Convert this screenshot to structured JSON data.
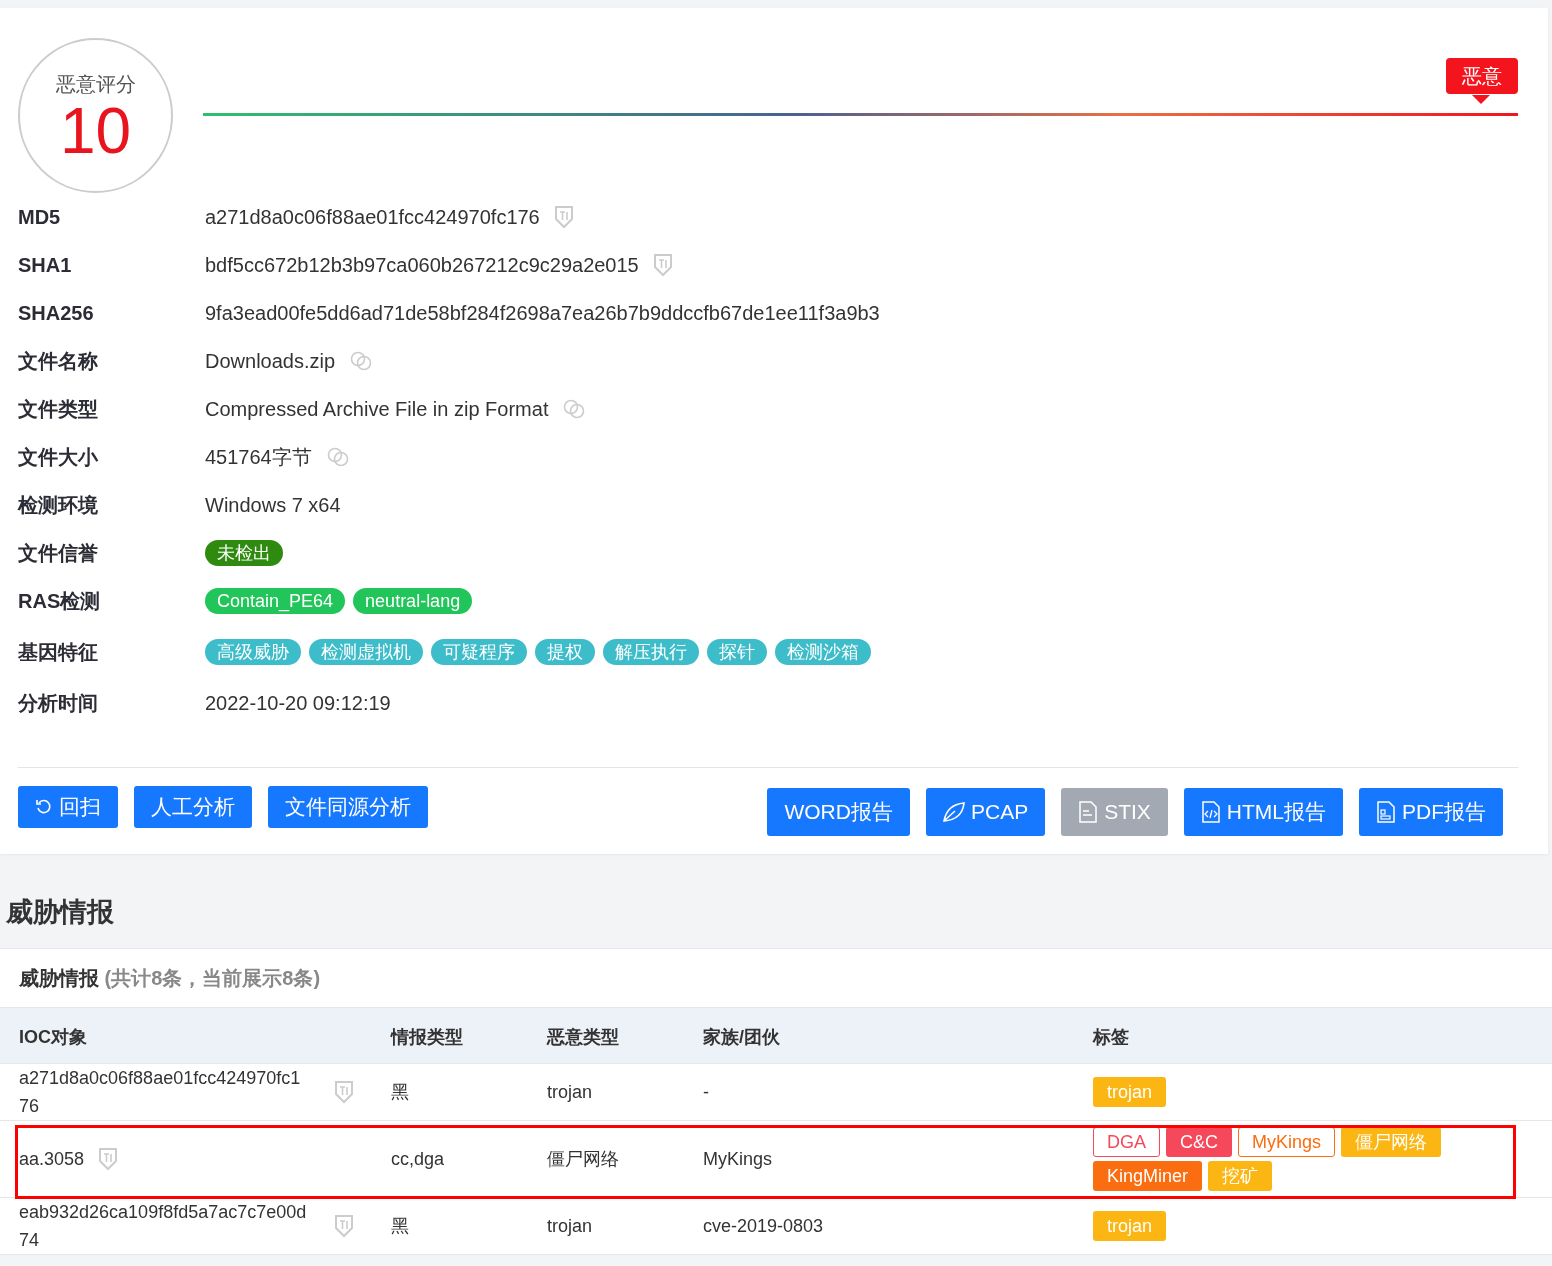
{
  "score": {
    "label": "恶意评分",
    "value": "10",
    "verdict": "恶意"
  },
  "fields": [
    {
      "label": "MD5",
      "kind": "hash",
      "value": "a271d8a0c06f88ae01fcc424970fc176"
    },
    {
      "label": "SHA1",
      "kind": "hash",
      "value": "bdf5cc672b12b3b97ca060b267212c9c29a2e015"
    },
    {
      "label": "SHA256",
      "kind": "text",
      "value": "9fa3ead00fe5dd6ad71de58bf284f2698a7ea26b7b9ddccfb67de1ee11f3a9b3"
    },
    {
      "label": "文件名称",
      "kind": "linked",
      "value": "Downloads.zip"
    },
    {
      "label": "文件类型",
      "kind": "linked",
      "value": "Compressed Archive File in zip Format"
    },
    {
      "label": "文件大小",
      "kind": "linked",
      "value": "451764字节"
    },
    {
      "label": "检测环境",
      "kind": "text",
      "value": "Windows 7 x64"
    },
    {
      "label": "文件信誉",
      "kind": "tags",
      "tags": [
        {
          "text": "未检出",
          "color": "#2f8a10"
        }
      ]
    },
    {
      "label": "RAS检测",
      "kind": "tags",
      "tags": [
        {
          "text": "Contain_PE64",
          "color": "#22c55a"
        },
        {
          "text": "neutral-lang",
          "color": "#22c55a"
        }
      ]
    },
    {
      "label": "基因特征",
      "kind": "tags",
      "tags": [
        {
          "text": "高级威胁",
          "color": "#3dbcc9"
        },
        {
          "text": "检测虚拟机",
          "color": "#3dbcc9"
        },
        {
          "text": "可疑程序",
          "color": "#3dbcc9"
        },
        {
          "text": "提权",
          "color": "#3dbcc9"
        },
        {
          "text": "解压执行",
          "color": "#3dbcc9"
        },
        {
          "text": "探针",
          "color": "#3dbcc9"
        },
        {
          "text": "检测沙箱",
          "color": "#3dbcc9"
        }
      ]
    },
    {
      "label": "分析时间",
      "kind": "text",
      "value": "2022-10-20 09:12:19"
    }
  ],
  "actions_left": [
    {
      "label": "回扫",
      "kind": "refresh"
    },
    {
      "label": "人工分析",
      "kind": "plain"
    },
    {
      "label": "文件同源分析",
      "kind": "plain"
    }
  ],
  "actions_right": [
    {
      "label": "WORD报告",
      "kind": "plain",
      "disabled": false
    },
    {
      "label": "PCAP",
      "kind": "pcap",
      "disabled": false
    },
    {
      "label": "STIX",
      "kind": "file",
      "disabled": true
    },
    {
      "label": "HTML报告",
      "kind": "code",
      "disabled": false
    },
    {
      "label": "PDF报告",
      "kind": "pdf",
      "disabled": false
    }
  ],
  "section_title": "威胁情报",
  "intel": {
    "title": "威胁情报",
    "count": "(共计8条，当前展示8条)",
    "columns": [
      "IOC对象",
      "情报类型",
      "恶意类型",
      "家族/团伙",
      "标签"
    ],
    "rows": [
      {
        "ioc": "a271d8a0c06f88ae01fcc424970fc176",
        "intel_type": "黑",
        "malware_type": "trojan",
        "family": "-",
        "highlighted": false,
        "tags": [
          {
            "text": "trojan",
            "color": "#fbb614",
            "kind": "solid"
          }
        ]
      },
      {
        "ioc": "aa.3058",
        "intel_type": "cc,dga",
        "malware_type": "僵尸网络",
        "family": "MyKings",
        "highlighted": true,
        "tags": [
          {
            "text": "DGA",
            "color": "#f5495b",
            "kind": "outline"
          },
          {
            "text": "C&C",
            "color": "#f5495b",
            "kind": "solid"
          },
          {
            "text": "MyKings",
            "color": "#fa6d10",
            "kind": "outline"
          },
          {
            "text": "僵尸网络",
            "color": "#fbb614",
            "kind": "solid"
          },
          {
            "text": "KingMiner",
            "color": "#fa6d10",
            "kind": "solid"
          },
          {
            "text": "挖矿",
            "color": "#fbb614",
            "kind": "solid"
          }
        ]
      },
      {
        "ioc": "eab932d26ca109f8fd5a7ac7c7e00d74",
        "intel_type": "黑",
        "malware_type": "trojan",
        "family": "cve-2019-0803",
        "highlighted": false,
        "tags": [
          {
            "text": "trojan",
            "color": "#fbb614",
            "kind": "solid"
          }
        ]
      }
    ]
  }
}
